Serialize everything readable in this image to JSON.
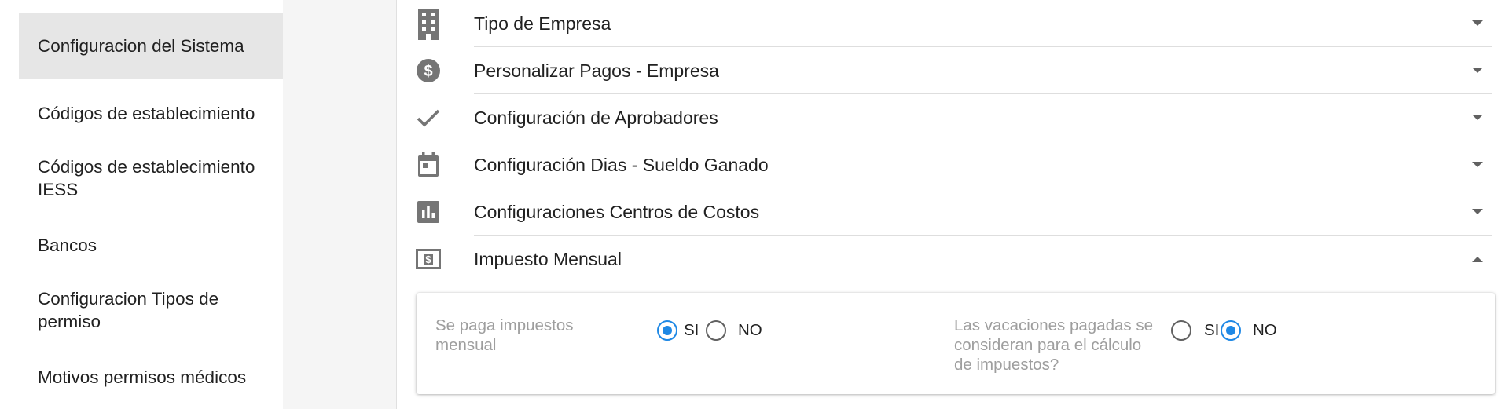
{
  "sidebar": {
    "items": [
      {
        "label": "Configuracion del Sistema",
        "active": true
      },
      {
        "label": "Códigos de establecimiento"
      },
      {
        "label": "Códigos de establecimiento IESS"
      },
      {
        "label": "Bancos"
      },
      {
        "label": "Configuracion Tipos de permiso"
      },
      {
        "label": "Motivos permisos médicos"
      }
    ]
  },
  "sections": [
    {
      "label": "Tipo de Empresa",
      "icon": "building-icon",
      "expanded": false
    },
    {
      "label": "Personalizar Pagos - Empresa",
      "icon": "dollar-circle-icon",
      "expanded": false
    },
    {
      "label": "Configuración de Aprobadores",
      "icon": "check-icon",
      "expanded": false
    },
    {
      "label": "Configuración Dias - Sueldo Ganado",
      "icon": "calendar-icon",
      "expanded": false
    },
    {
      "label": "Configuraciones Centros de Costos",
      "icon": "bar-chart-icon",
      "expanded": false
    },
    {
      "label": "Impuesto Mensual",
      "icon": "money-bill-icon",
      "expanded": true
    }
  ],
  "impuesto_mensual": {
    "monthly_tax": {
      "label": "Se paga impuestos mensual",
      "option_si": "SI",
      "option_no": "NO",
      "selected": "SI"
    },
    "vacation_tax": {
      "label": "Las vacaciones pagadas se consideran para el cálculo de impuestos?",
      "option_si": "SI",
      "option_no": "NO",
      "selected": "NO"
    }
  },
  "colors": {
    "accent": "#1e88e5",
    "icon_gray": "#757575",
    "active_bg": "#e6e6e6",
    "muted_text": "#9e9e9e"
  }
}
